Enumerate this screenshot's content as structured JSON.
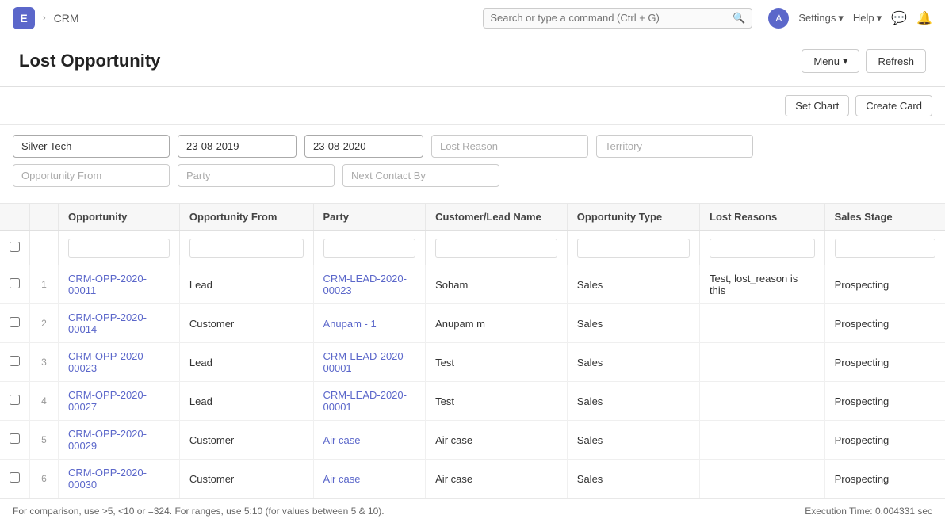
{
  "navbar": {
    "logo": "E",
    "app_name": "CRM",
    "search_placeholder": "Search or type a command (Ctrl + G)",
    "avatar": "A",
    "settings_label": "Settings",
    "help_label": "Help"
  },
  "page": {
    "title": "Lost Opportunity",
    "menu_label": "Menu",
    "refresh_label": "Refresh",
    "set_chart_label": "Set Chart",
    "create_card_label": "Create Card"
  },
  "filters": {
    "company": "Silver Tech",
    "date_from": "23-08-2019",
    "date_to": "23-08-2020",
    "lost_reason_placeholder": "Lost Reason",
    "territory_placeholder": "Territory",
    "opp_from_placeholder": "Opportunity From",
    "party_placeholder": "Party",
    "next_contact_placeholder": "Next Contact By"
  },
  "table": {
    "columns": [
      "Opportunity",
      "Opportunity From",
      "Party",
      "Customer/Lead Name",
      "Opportunity Type",
      "Lost Reasons",
      "Sales Stage"
    ],
    "rows": [
      {
        "num": "1",
        "opportunity": "CRM-OPP-2020-00011",
        "opp_from": "Lead",
        "party": "CRM-LEAD-2020-00023",
        "customer_lead": "Soham",
        "opp_type": "Sales",
        "lost_reasons": "Test, lost_reason is this",
        "sales_stage": "Prospecting"
      },
      {
        "num": "2",
        "opportunity": "CRM-OPP-2020-00014",
        "opp_from": "Customer",
        "party": "Anupam - 1",
        "customer_lead": "Anupam m",
        "opp_type": "Sales",
        "lost_reasons": "",
        "sales_stage": "Prospecting"
      },
      {
        "num": "3",
        "opportunity": "CRM-OPP-2020-00023",
        "opp_from": "Lead",
        "party": "CRM-LEAD-2020-00001",
        "customer_lead": "Test",
        "opp_type": "Sales",
        "lost_reasons": "",
        "sales_stage": "Prospecting"
      },
      {
        "num": "4",
        "opportunity": "CRM-OPP-2020-00027",
        "opp_from": "Lead",
        "party": "CRM-LEAD-2020-00001",
        "customer_lead": "Test",
        "opp_type": "Sales",
        "lost_reasons": "",
        "sales_stage": "Prospecting"
      },
      {
        "num": "5",
        "opportunity": "CRM-OPP-2020-00029",
        "opp_from": "Customer",
        "party": "Air case",
        "customer_lead": "Air case",
        "opp_type": "Sales",
        "lost_reasons": "",
        "sales_stage": "Prospecting"
      },
      {
        "num": "6",
        "opportunity": "CRM-OPP-2020-00030",
        "opp_from": "Customer",
        "party": "Air case",
        "customer_lead": "Air case",
        "opp_type": "Sales",
        "lost_reasons": "",
        "sales_stage": "Prospecting"
      }
    ]
  },
  "footer": {
    "hint": "For comparison, use >5, <10 or =324. For ranges, use 5:10 (for values between 5 & 10).",
    "execution_time": "Execution Time: 0.004331 sec"
  }
}
